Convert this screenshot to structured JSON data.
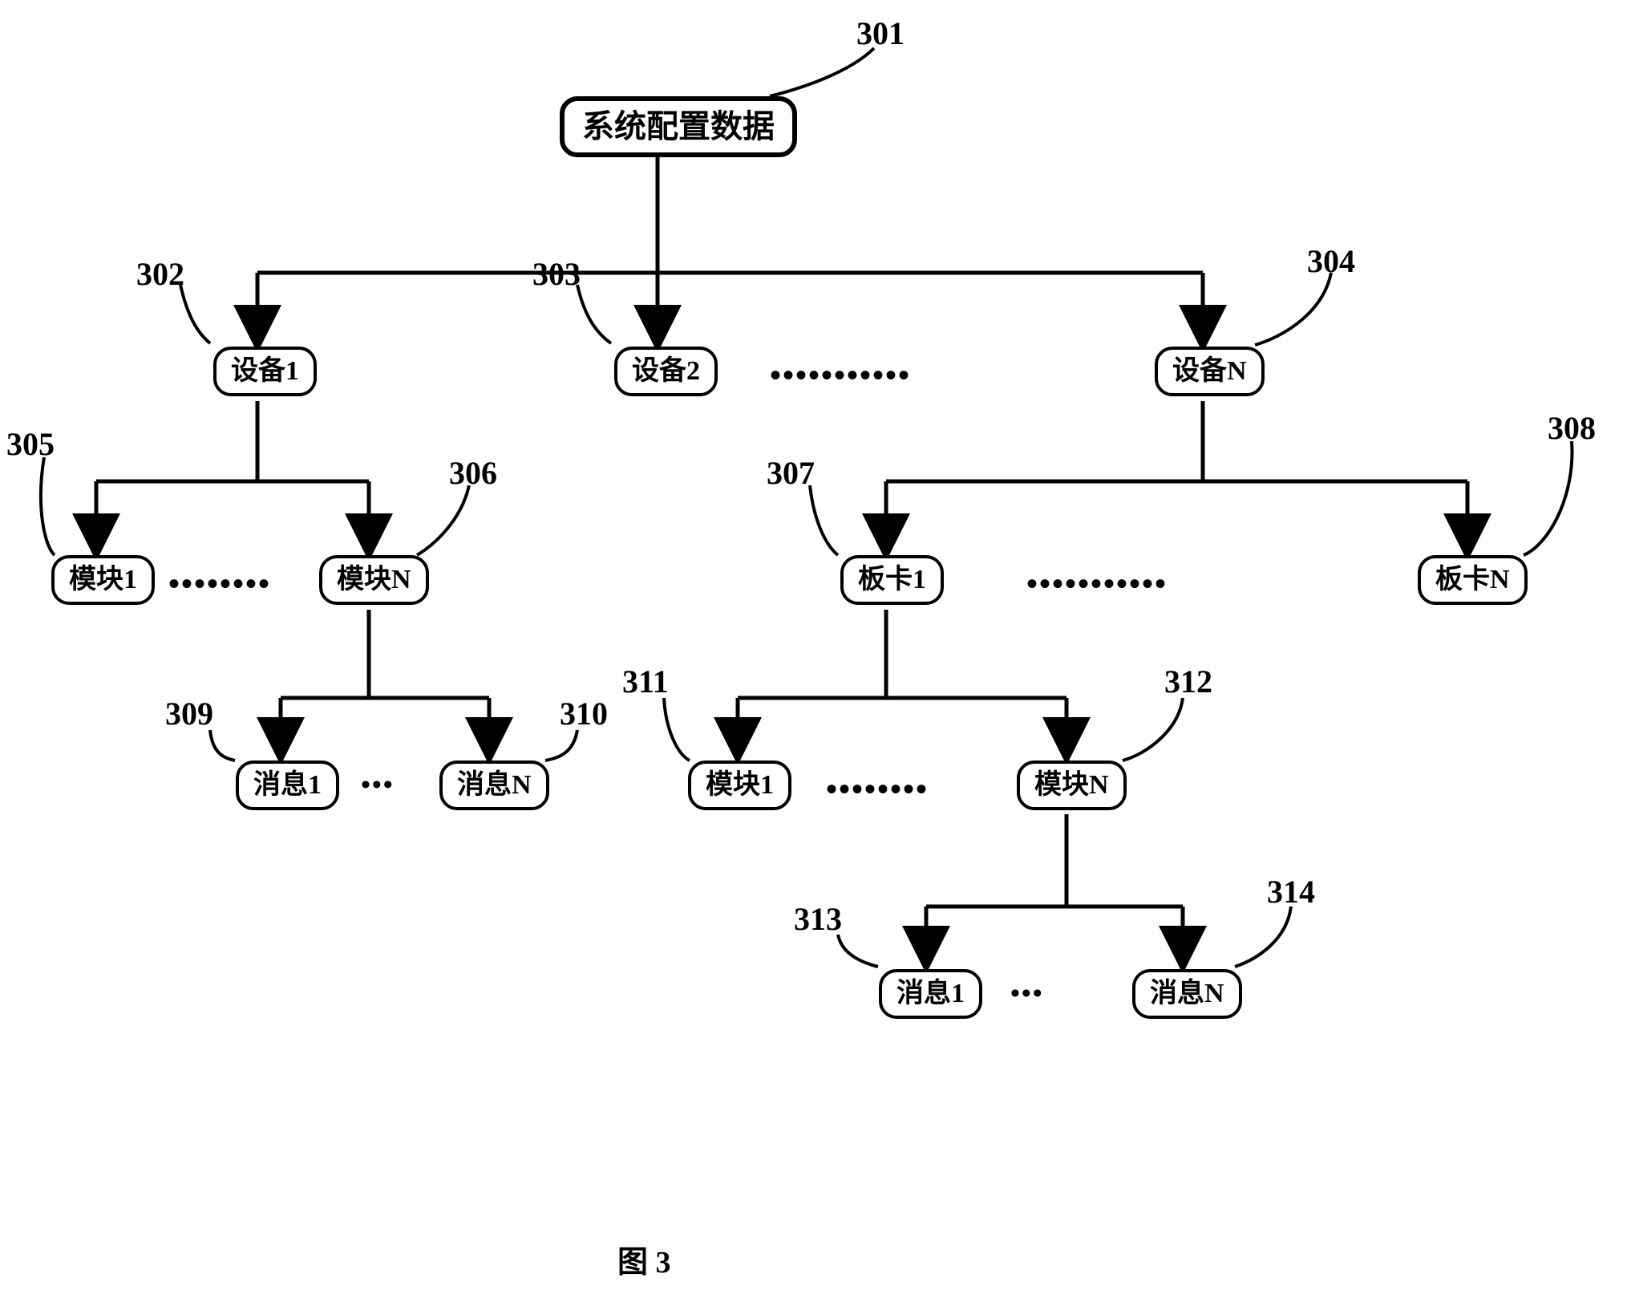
{
  "nodes": {
    "n301": "系统配置数据",
    "n302": "设备1",
    "n303": "设备2",
    "n304": "设备N",
    "n305": "模块1",
    "n306": "模块N",
    "n307": "板卡1",
    "n308": "板卡N",
    "n309": "消息1",
    "n310": "消息N",
    "n311": "模块1",
    "n312": "模块N",
    "n313": "消息1",
    "n314": "消息N"
  },
  "refs": {
    "r301": "301",
    "r302": "302",
    "r303": "303",
    "r304": "304",
    "r305": "305",
    "r306": "306",
    "r307": "307",
    "r308": "308",
    "r309": "309",
    "r310": "310",
    "r311": "311",
    "r312": "312",
    "r313": "313",
    "r314": "314"
  },
  "dots": {
    "long": "•••••••••••",
    "mid": "••••••••",
    "short": "•••"
  },
  "caption": "图 3"
}
